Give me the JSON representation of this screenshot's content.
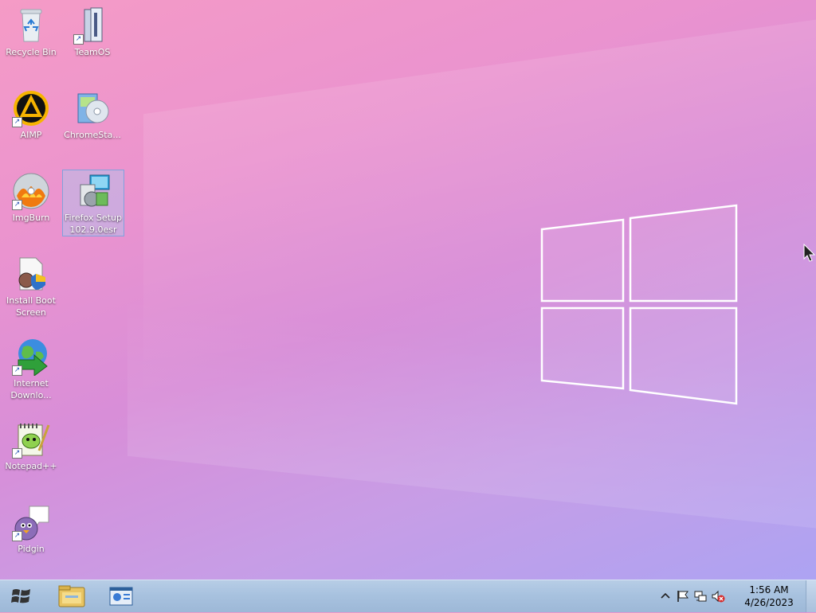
{
  "desktop": {
    "icons": [
      {
        "label": "Recycle Bin",
        "icon": "recycle-bin-icon",
        "shortcut": false
      },
      {
        "label": "TeamOS",
        "icon": "folder-icon",
        "shortcut": true
      },
      {
        "label": "AIMP",
        "icon": "aimp-icon",
        "shortcut": true
      },
      {
        "label": "ChromeSta...",
        "icon": "installer-cd-icon",
        "shortcut": false
      },
      {
        "label": "ImgBurn",
        "icon": "imgburn-disc-icon",
        "shortcut": true
      },
      {
        "label": "Firefox Setup 102.9.0esr",
        "icon": "setup-installer-icon",
        "shortcut": false,
        "selected": true
      },
      {
        "label": "Install Boot Screen",
        "icon": "boot-installer-icon",
        "shortcut": false
      },
      {
        "label": "Internet Downlo...",
        "icon": "internet-download-manager-icon",
        "shortcut": true
      },
      {
        "label": "Notepad++",
        "icon": "notepad-plus-plus-icon",
        "shortcut": true
      },
      {
        "label": "Pidgin",
        "icon": "pidgin-icon",
        "shortcut": true
      }
    ]
  },
  "taskbar": {
    "start_icon": "windows-logo-icon",
    "pinned": [
      {
        "icon": "file-explorer-icon"
      },
      {
        "icon": "control-panel-icon"
      }
    ],
    "tray": {
      "icons": [
        "show-hidden-icons-chevron-icon",
        "action-center-flag-icon",
        "network-icon",
        "volume-muted-icon"
      ]
    },
    "clock": {
      "time": "1:56 AM",
      "date": "4/26/2023"
    }
  },
  "colors": {
    "taskbar": "#a8c2df",
    "wallpaper_pink": "#f59bc6",
    "wallpaper_purple": "#c79de6",
    "wallpaper_blue": "#a9a4f4",
    "selection": "#adc8f0"
  }
}
